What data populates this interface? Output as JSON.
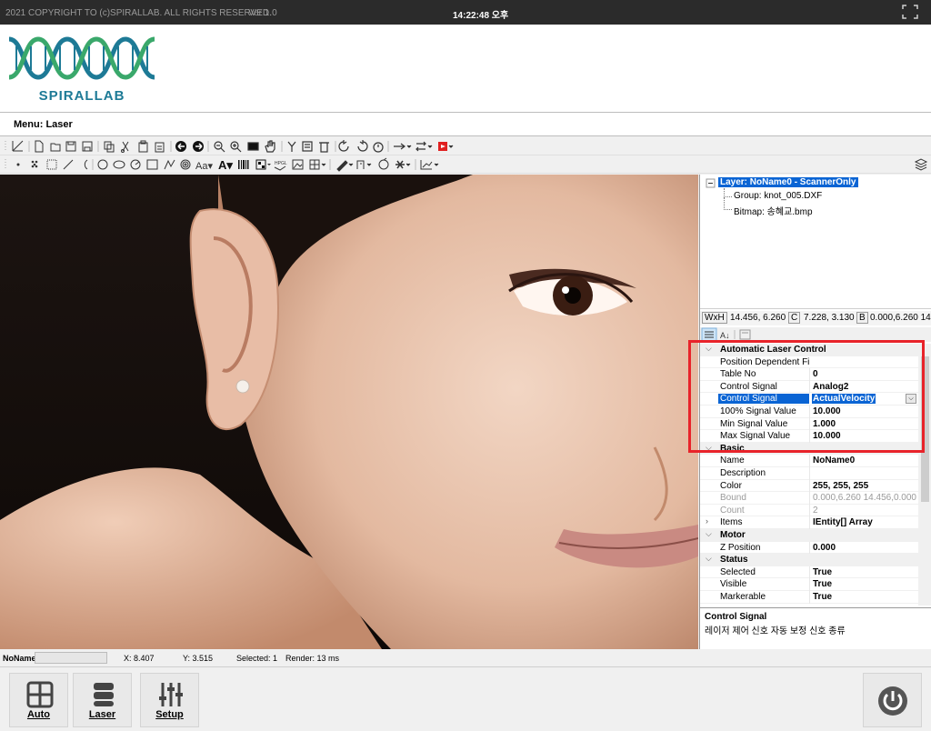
{
  "topbar": {
    "copyright": "2021 COPYRIGHT TO (c)SPIRALLAB. ALL RIGHTS RESERVED.",
    "version": "Ver 1.0",
    "clock": "14:22:48 오후",
    "fullscreen_icon": "fullscreen-icon"
  },
  "logo": {
    "brand": "SPIRALLAB",
    "colors": {
      "teal": "#1d7a96",
      "green": "#3aa86b"
    }
  },
  "menu": {
    "label": "Menu: Laser"
  },
  "tree": {
    "root": "Layer: NoName0 - ScannerOnly",
    "children": [
      "Group: knot_005.DXF",
      "Bitmap: 송혜교.bmp"
    ]
  },
  "boxbar": {
    "wxh_label": "WxH",
    "wxh": "14.456, 6.260",
    "c_label": "C",
    "c": "7.228, 3.130",
    "b_label": "B",
    "b": "0.000,6.260 14"
  },
  "grid": {
    "alc": {
      "title": "Automatic Laser Control",
      "rows": [
        {
          "k": "Position Dependent Fi",
          "v": ""
        },
        {
          "k": "Table No",
          "v": "0"
        },
        {
          "k": "Control Signal",
          "v": "Analog2"
        },
        {
          "k": "Control Signal",
          "v": "ActualVelocity"
        },
        {
          "k": "100% Signal Value",
          "v": "10.000"
        },
        {
          "k": "Min Signal Value",
          "v": "1.000"
        },
        {
          "k": "Max Signal Value",
          "v": "10.000"
        }
      ]
    },
    "basic": {
      "title": "Basic",
      "rows": [
        {
          "k": "Name",
          "v": "NoName0"
        },
        {
          "k": "Description",
          "v": ""
        },
        {
          "k": "Color",
          "v": "255, 255, 255"
        },
        {
          "k": "Bound",
          "v": "0.000,6.260 14.456,0.000"
        },
        {
          "k": "Count",
          "v": "2"
        },
        {
          "k": "Items",
          "v": "IEntity[] Array"
        }
      ]
    },
    "motor": {
      "title": "Motor",
      "rows": [
        {
          "k": "Z Position",
          "v": "0.000"
        }
      ]
    },
    "status": {
      "title": "Status",
      "rows": [
        {
          "k": "Selected",
          "v": "True"
        },
        {
          "k": "Visible",
          "v": "True"
        },
        {
          "k": "Markerable",
          "v": "True"
        }
      ]
    }
  },
  "help": {
    "title": "Control Signal",
    "desc": "레이저 제어 신호 자동 보정 신호 종류"
  },
  "status": {
    "name": "NoName",
    "x": "X: 8.407",
    "y": "Y: 3.515",
    "selected": "Selected: 1",
    "render": "Render: 13 ms"
  },
  "nav": {
    "auto": "Auto",
    "laser": "Laser",
    "setup": "Setup"
  },
  "accent": {
    "selection": "#0a64d4",
    "highlight_box": "#e8232a"
  }
}
